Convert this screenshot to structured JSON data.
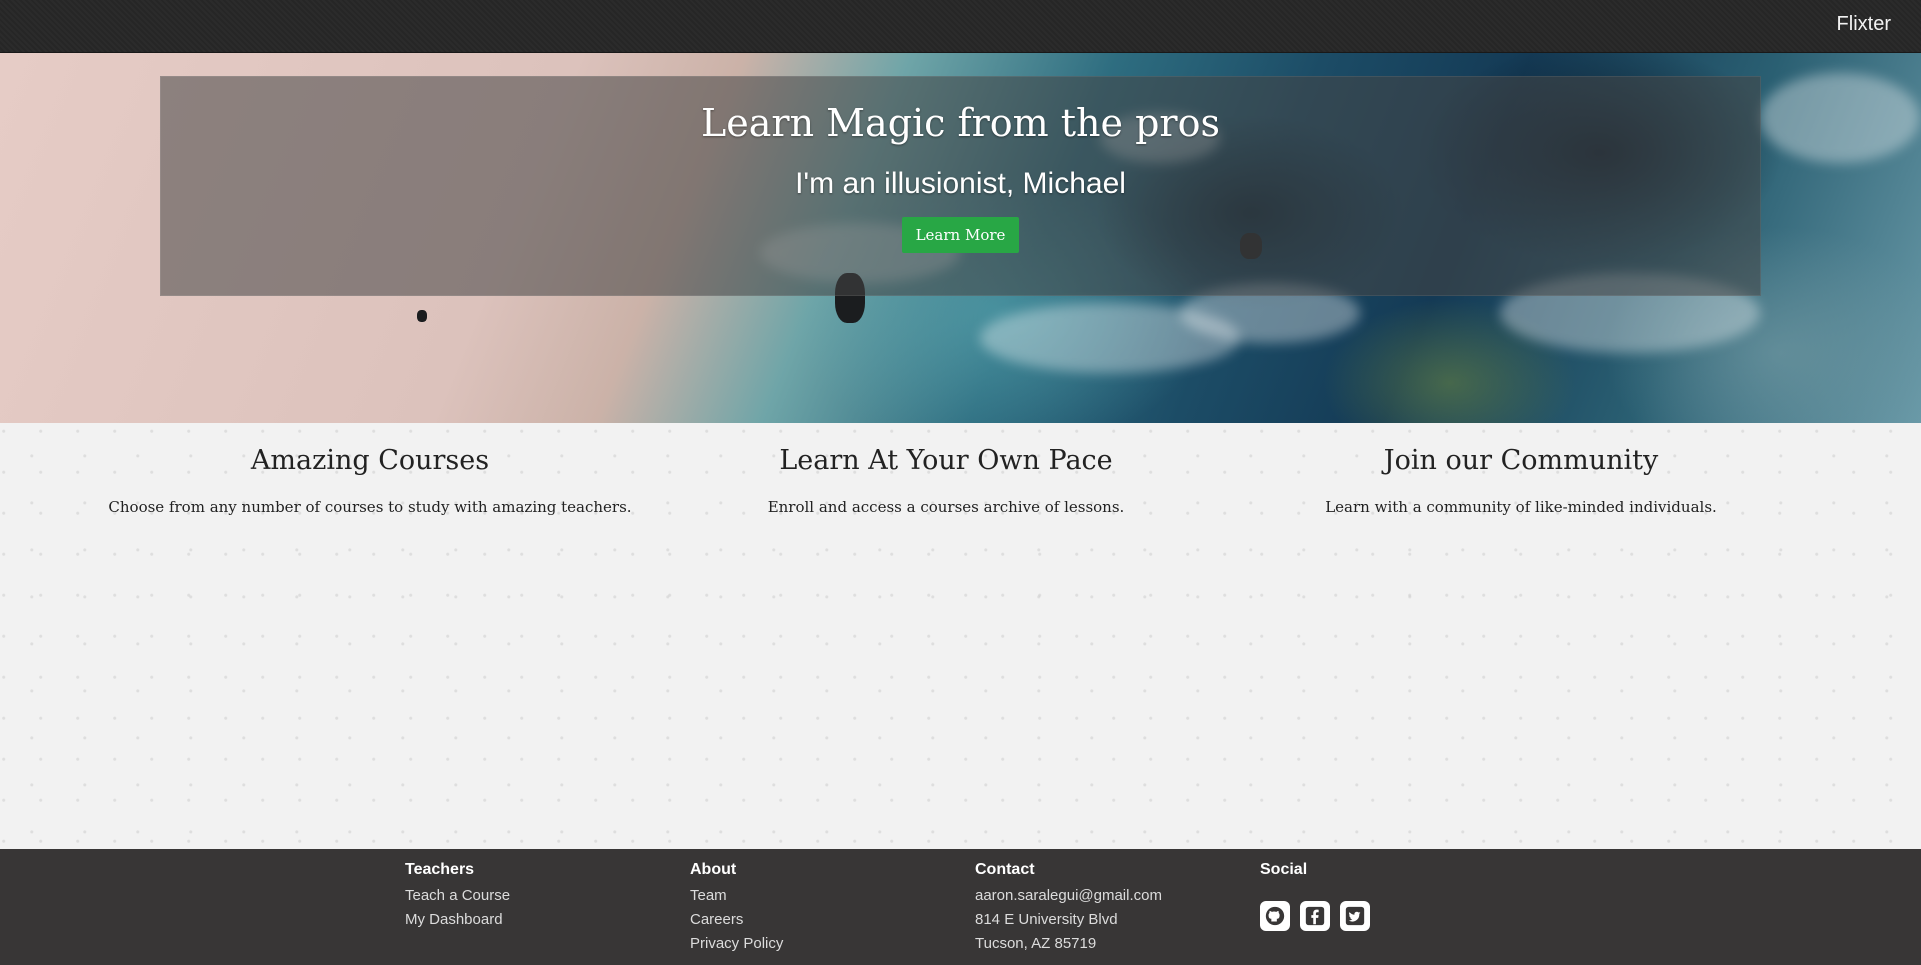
{
  "navbar": {
    "brand": "Flixter"
  },
  "hero": {
    "title": "Learn Magic from the pros",
    "subtitle": "I'm an illusionist, Michael",
    "button_label": "Learn More"
  },
  "features": [
    {
      "title": "Amazing Courses",
      "text": "Choose from any number of courses to study with amazing teachers."
    },
    {
      "title": "Learn At Your Own Pace",
      "text": "Enroll and access a courses archive of lessons."
    },
    {
      "title": "Join our Community",
      "text": "Learn with a community of like-minded individuals."
    }
  ],
  "footer": {
    "teachers": {
      "heading": "Teachers",
      "links": [
        "Teach a Course",
        "My Dashboard"
      ]
    },
    "about": {
      "heading": "About",
      "links": [
        "Team",
        "Careers",
        "Privacy Policy"
      ]
    },
    "contact": {
      "heading": "Contact",
      "lines": [
        "aaron.saralegui@gmail.com",
        "814 E University Blvd",
        "Tucson, AZ 85719"
      ]
    },
    "social": {
      "heading": "Social",
      "icons": [
        "github-icon",
        "facebook-icon",
        "twitter-icon"
      ]
    }
  },
  "colors": {
    "accent_button": "#28a745",
    "navbar": "#2b2b2b",
    "footer": "#383636"
  }
}
